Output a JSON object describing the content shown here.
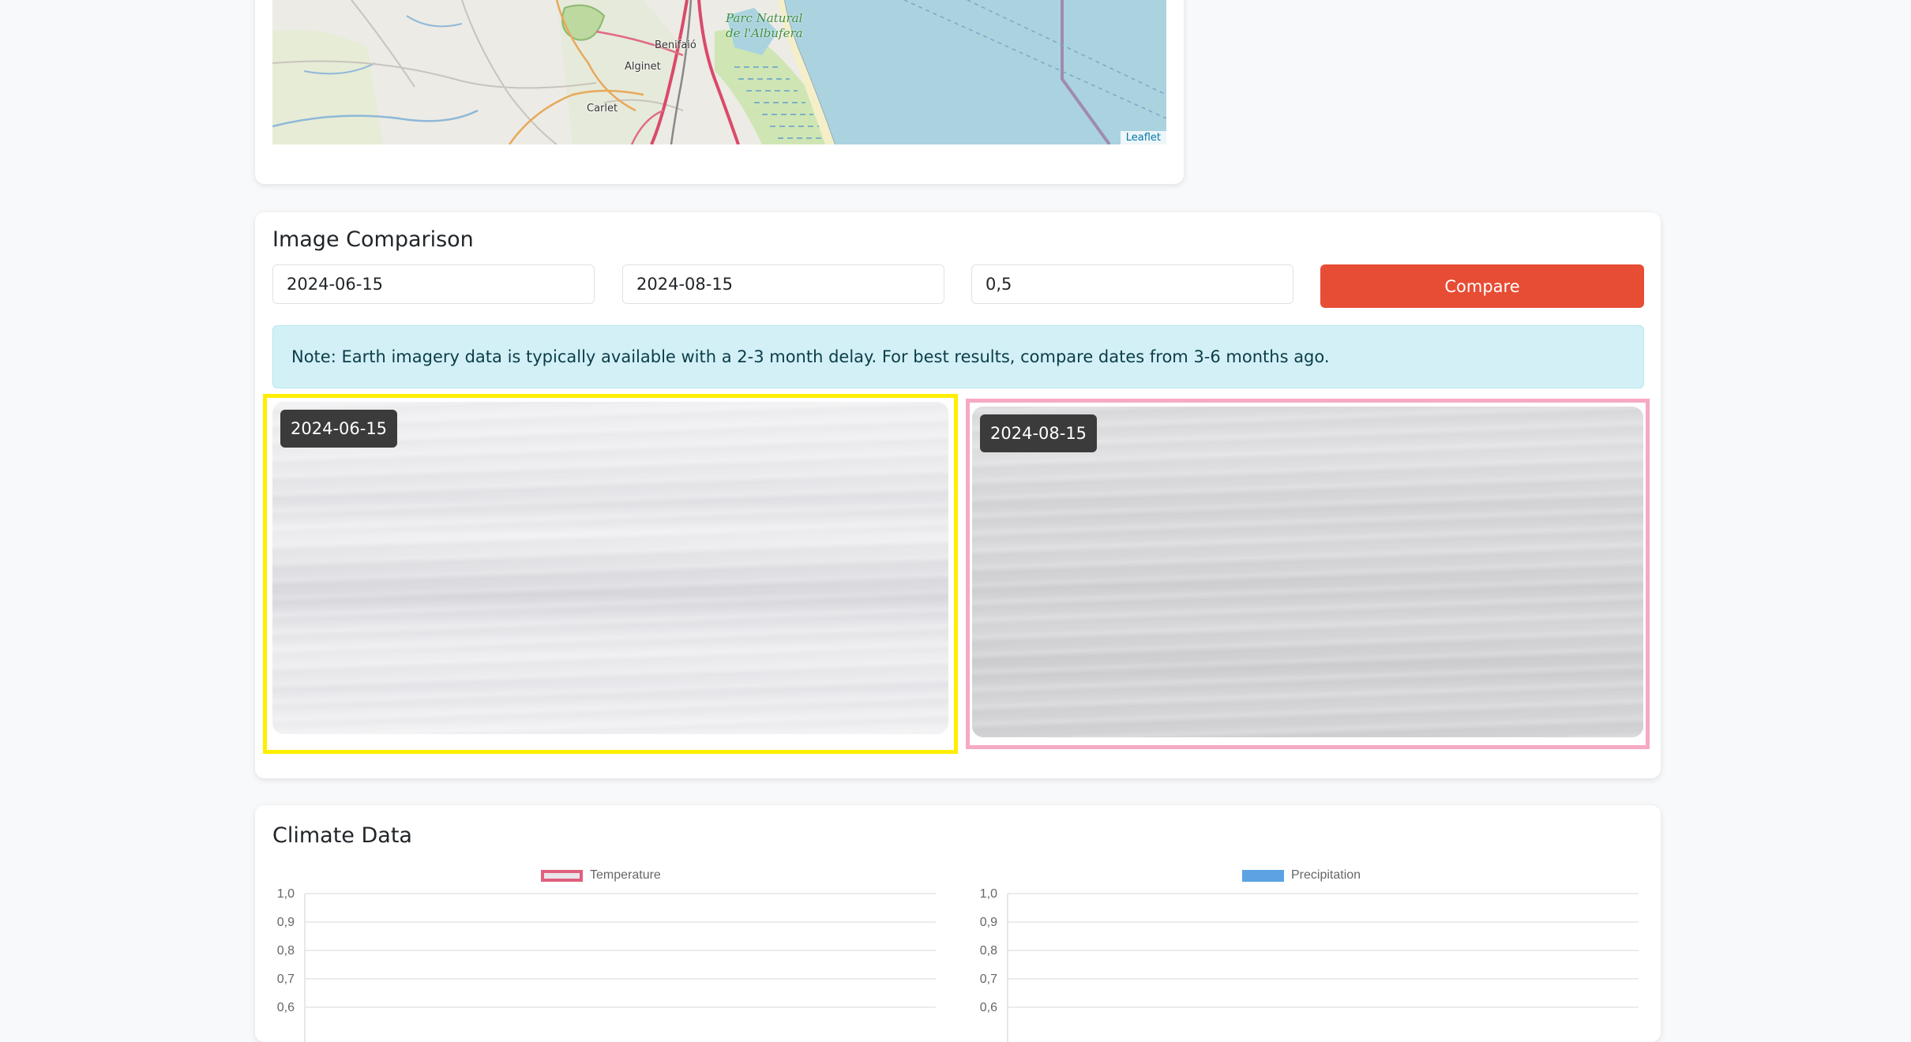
{
  "map": {
    "places": {
      "benifaio": "Benifaió",
      "alginet": "Alginet",
      "carlet": "Carlet",
      "park_line1": "Parc Natural",
      "park_line2": "de l'Albufera"
    },
    "attribution": "Leaflet"
  },
  "comparison": {
    "title": "Image Comparison",
    "date_a": "2024-06-15",
    "date_b": "2024-08-15",
    "cloud_threshold": "0,5",
    "compare_label": "Compare",
    "note": "Note: Earth imagery data is typically available with a 2-3 month delay. For best results, compare dates from 3-6 months ago.",
    "image_a_badge": "2024-06-15",
    "image_b_badge": "2024-08-15"
  },
  "climate": {
    "title": "Climate Data",
    "colors": {
      "temperature_border": "#e0607e",
      "precipitation_fill": "#5ba3e3"
    },
    "chart_data": [
      {
        "type": "line",
        "series": [
          {
            "name": "Temperature",
            "values": []
          }
        ],
        "ytick_labels": [
          "1,0",
          "0,9",
          "0,8",
          "0,7",
          "0,6"
        ],
        "ylim": [
          0,
          1
        ],
        "grid": true,
        "legend": "top"
      },
      {
        "type": "bar",
        "series": [
          {
            "name": "Precipitation",
            "values": []
          }
        ],
        "ytick_labels": [
          "1,0",
          "0,9",
          "0,8",
          "0,7",
          "0,6"
        ],
        "ylim": [
          0,
          1
        ],
        "grid": true,
        "legend": "top"
      }
    ]
  }
}
